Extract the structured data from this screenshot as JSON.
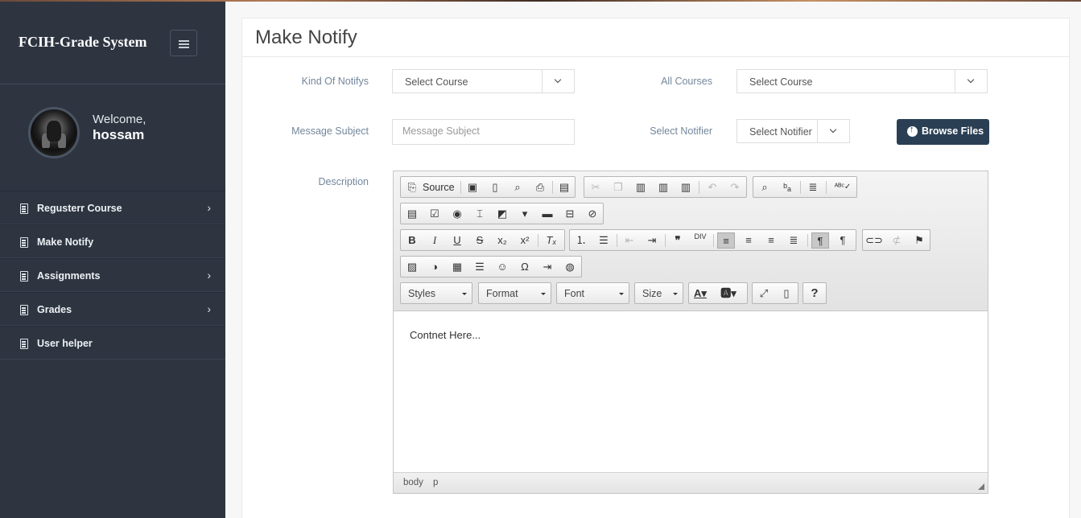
{
  "app": {
    "title": "FCIH-Grade System"
  },
  "profile": {
    "welcome": "Welcome,",
    "username": "hossam"
  },
  "sidebar": {
    "items": [
      {
        "label": "Regusterr Course",
        "has_submenu": true
      },
      {
        "label": "Make Notify",
        "has_submenu": false
      },
      {
        "label": "Assignments",
        "has_submenu": true
      },
      {
        "label": "Grades",
        "has_submenu": true
      },
      {
        "label": "User helper",
        "has_submenu": false
      }
    ]
  },
  "page": {
    "title": "Make Notify"
  },
  "form": {
    "kind_label": "Kind Of Notifys",
    "kind_value": "Select Course",
    "courses_label": "All Courses",
    "courses_value": "Select Course",
    "subject_label": "Message Subject",
    "subject_placeholder": "Message Subject",
    "notifier_label": "Select Notifier",
    "notifier_value": "Select Notifier",
    "browse_label": "Browse Files",
    "description_label": "Description"
  },
  "editor": {
    "source_label": "Source",
    "styles_label": "Styles",
    "format_label": "Format",
    "font_label": "Font",
    "size_label": "Size",
    "help_label": "?",
    "content": "Contnet Here...",
    "status_path": [
      "body",
      "p"
    ]
  },
  "colors": {
    "sidebar": "#2e3541",
    "button": "#2a3f54",
    "label": "#73879c"
  }
}
